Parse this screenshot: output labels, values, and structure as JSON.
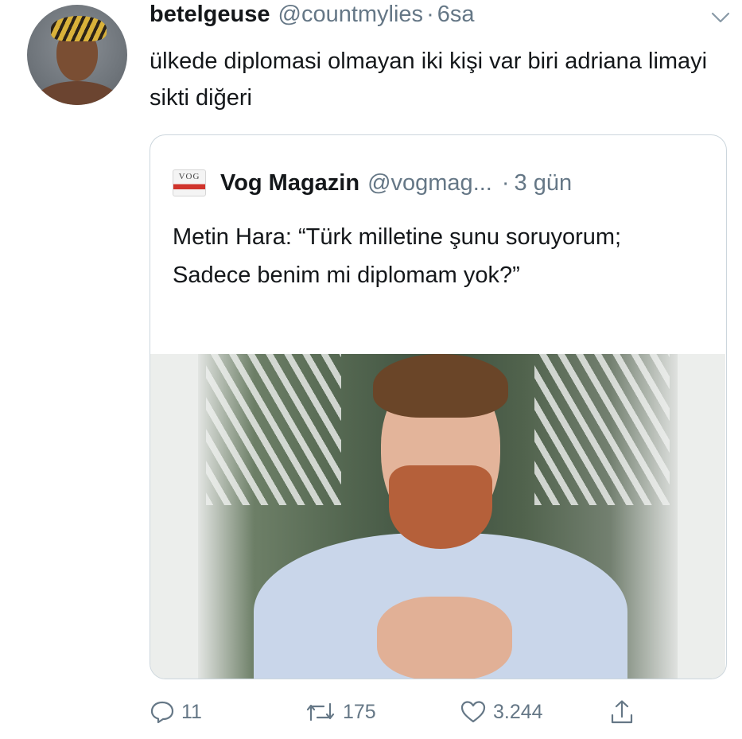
{
  "tweet": {
    "author_name": "betelgeuse",
    "author_handle": "@countmylies",
    "separator": "·",
    "time": "6sa",
    "text": "ülkede diplomasi olmayan iki kişi var biri adriana limayi sikti diğeri"
  },
  "quoted": {
    "author_name": "Vog Magazin",
    "author_handle": "@vogmag...",
    "separator": "·",
    "time": "3 gün",
    "logo_text": "VOG",
    "text": "Metin Hara: “Türk milletine şunu soruyorum; Sadece benim mi diplomam yok?”"
  },
  "actions": {
    "reply_count": "11",
    "retweet_count": "175",
    "like_count": "3.244"
  },
  "icons": [
    "avatar",
    "chevron-down-icon",
    "magazine-logo",
    "reply-icon",
    "retweet-icon",
    "like-icon",
    "share-icon"
  ],
  "colors": {
    "text": "#14171a",
    "secondary": "#657786",
    "border": "#ccd6dd"
  }
}
